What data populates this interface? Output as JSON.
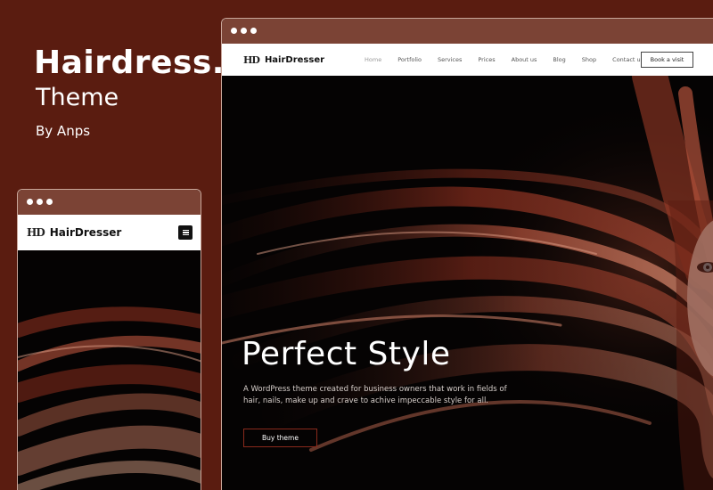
{
  "promo": {
    "title": "Hairdress..",
    "subtitle": "Theme",
    "author": "By Anps"
  },
  "site": {
    "logo_mark": "HD",
    "logo_text": "HairDresser",
    "nav": [
      {
        "label": "Home",
        "active": true
      },
      {
        "label": "Portfolio"
      },
      {
        "label": "Services"
      },
      {
        "label": "Prices"
      },
      {
        "label": "About us"
      },
      {
        "label": "Blog"
      },
      {
        "label": "Shop"
      },
      {
        "label": "Contact us"
      }
    ],
    "book_label": "Book a visit"
  },
  "hero": {
    "title": "Perfect Style",
    "text": "A WordPress theme created for business owners that work in fields of hair, nails, make up and crave to achive impeccable style for all.",
    "buy_label": "Buy theme"
  },
  "colors": {
    "background": "#5a1c10",
    "browser_bar": "#7b4335",
    "hair": "#8a2e1e",
    "button_border": "#8a2a1c"
  },
  "icons": {
    "window_dots": "dots",
    "mobile_menu": "hamburger-icon"
  }
}
